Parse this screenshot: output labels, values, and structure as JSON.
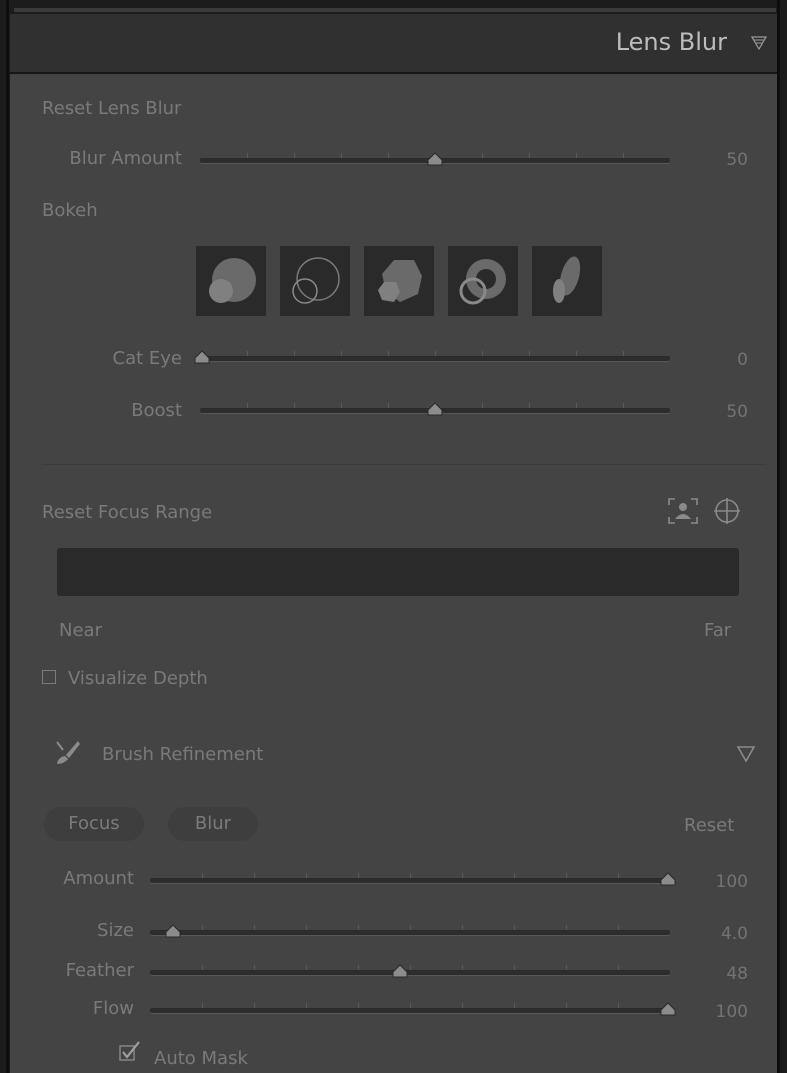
{
  "panel": {
    "title": "Lens Blur",
    "collapse_icon": "panel-collapse-triangle-icon"
  },
  "lens_blur": {
    "reset_label": "Reset Lens Blur",
    "blur_amount": {
      "label": "Blur Amount",
      "value": "50",
      "level": 50
    },
    "bokeh_label": "Bokeh",
    "bokeh_shapes": [
      "circle-bokeh-icon",
      "bubble-bokeh-icon",
      "blade-bokeh-icon",
      "ring-bokeh-icon",
      "cat-eye-bokeh-icon"
    ],
    "cat_eye": {
      "label": "Cat Eye",
      "value": "0",
      "level": 0
    },
    "boost": {
      "label": "Boost",
      "value": "50",
      "level": 50
    }
  },
  "focus_range": {
    "reset_label": "Reset Focus Range",
    "near_label": "Near",
    "far_label": "Far",
    "visualize_depth_label": "Visualize Depth",
    "visualize_depth_checked": false
  },
  "brush": {
    "title": "Brush Refinement",
    "focus_tab": "Focus",
    "blur_tab": "Blur",
    "reset_label": "Reset",
    "amount": {
      "label": "Amount",
      "value": "100",
      "level": 100
    },
    "size": {
      "label": "Size",
      "value": "4.0",
      "level": 4
    },
    "feather": {
      "label": "Feather",
      "value": "48",
      "level": 48
    },
    "flow": {
      "label": "Flow",
      "value": "100",
      "level": 100
    },
    "auto_mask_label": "Auto Mask",
    "auto_mask_checked": true
  },
  "colors": {
    "panel_bg": "#444444",
    "header_bg": "#303030",
    "text": "#7a7a7a",
    "title_text": "#bdbdbd"
  }
}
